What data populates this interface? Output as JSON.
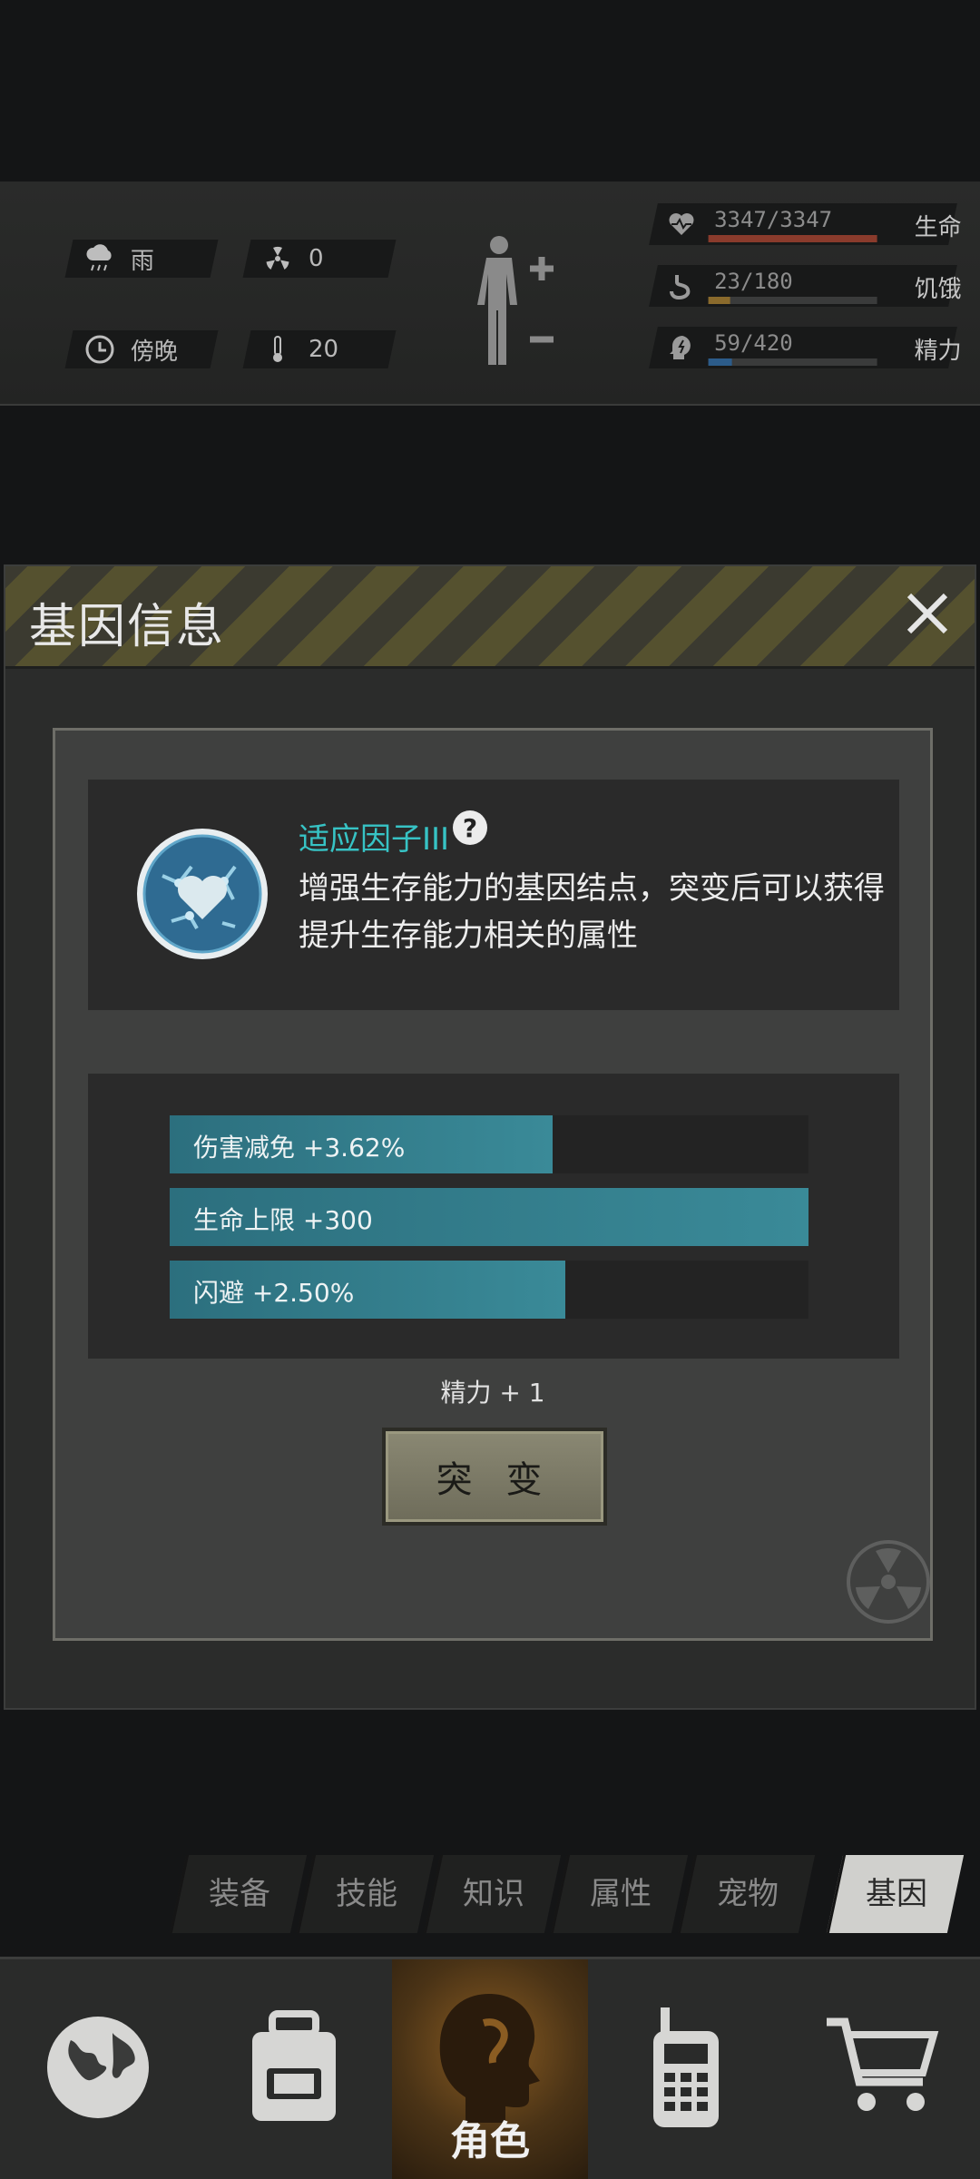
{
  "status": {
    "weather": "雨",
    "radiation": "0",
    "time_of_day": "傍晚",
    "temperature": "20",
    "body_icon": "body-plus-minus-icon",
    "stats": [
      {
        "icon": "heart-pulse-icon",
        "value": "3347/3347",
        "name": "生命",
        "fill": 1.0,
        "color": "#8a3b2c"
      },
      {
        "icon": "stomach-icon",
        "value": "23/180",
        "name": "饥饿",
        "fill": 0.13,
        "color": "#8a6a2c"
      },
      {
        "icon": "head-energy-icon",
        "value": "59/420",
        "name": "精力",
        "fill": 0.14,
        "color": "#2c5c8a"
      }
    ]
  },
  "dialog": {
    "title": "基因信息",
    "close_icon": "close-icon",
    "gene": {
      "name": "适应因子III",
      "help": "?",
      "description": "增强生存能力的基因结点，突变后可以获得提升生存能力相关的属性",
      "icon": "heart-gene-icon"
    },
    "attributes": [
      {
        "label": "伤害减免 +3.62%",
        "fill": 0.6
      },
      {
        "label": "生命上限 +300",
        "fill": 1.0
      },
      {
        "label": "闪避 +2.50%",
        "fill": 0.62
      }
    ],
    "cost": "精力 + 1",
    "mutate_label": "突 变"
  },
  "tabs": [
    {
      "label": "装备",
      "active": false
    },
    {
      "label": "技能",
      "active": false
    },
    {
      "label": "知识",
      "active": false
    },
    {
      "label": "属性",
      "active": false
    },
    {
      "label": "宠物",
      "active": false
    },
    {
      "label": "基因",
      "active": true
    }
  ],
  "nav": {
    "items": [
      "globe-icon",
      "backpack-icon",
      "head-profile-icon",
      "walkie-talkie-icon",
      "shopping-cart-icon"
    ],
    "active_label": "角色"
  }
}
